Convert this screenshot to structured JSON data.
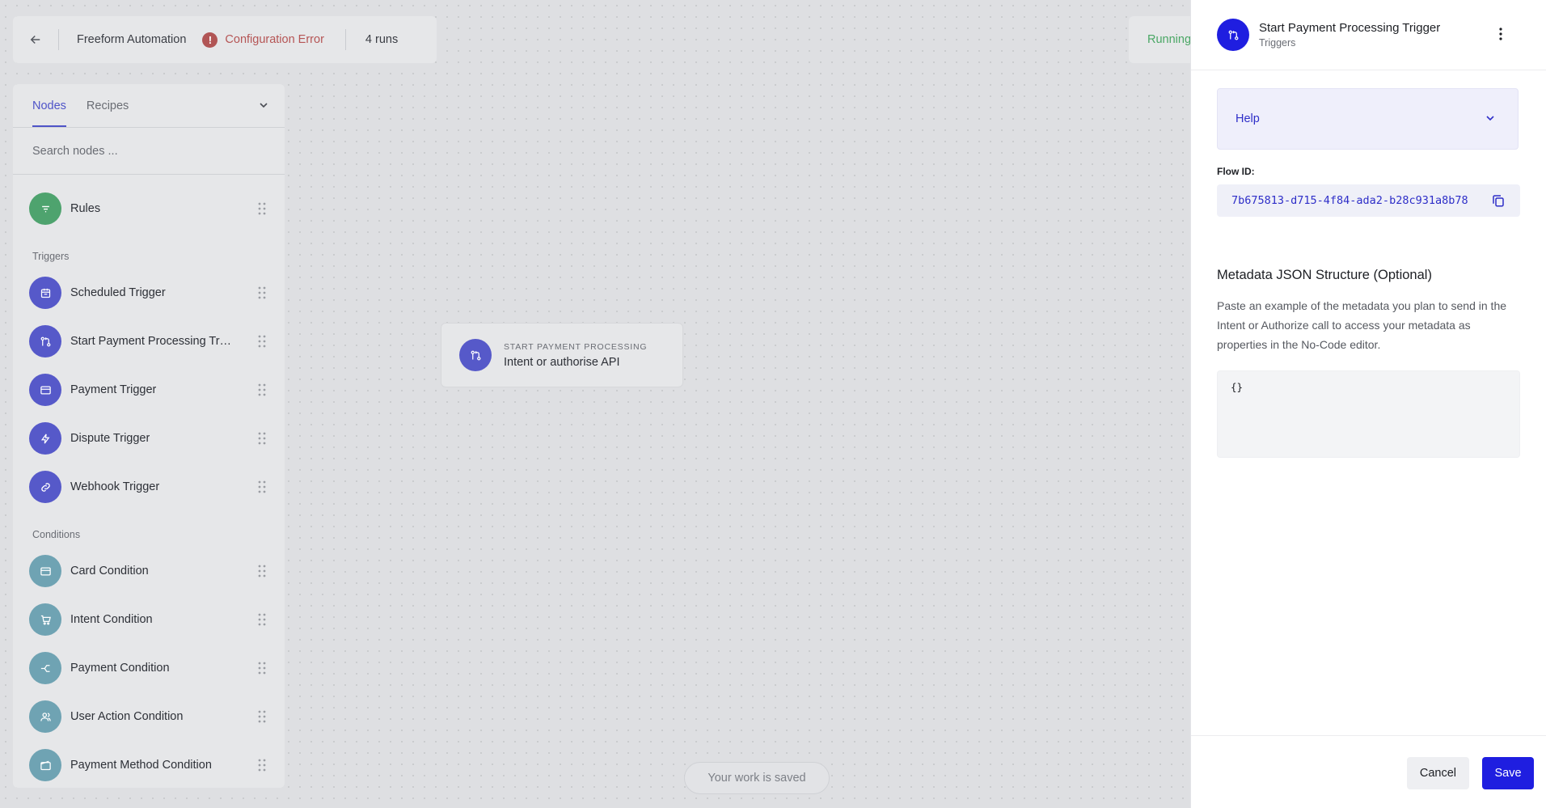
{
  "topbar": {
    "title": "Freeform Automation",
    "error_label": "Configuration Error",
    "error_icon": "!",
    "runs": "4 runs",
    "status": "Running"
  },
  "panel": {
    "tabs": [
      "Nodes",
      "Recipes"
    ],
    "active_tab": "Nodes",
    "search_placeholder": "Search nodes ...",
    "top_items": [
      {
        "label": "Rules",
        "icon": "filter-icon",
        "color": "#4ea36e"
      }
    ],
    "sections": [
      {
        "title": "Triggers",
        "items": [
          {
            "label": "Scheduled Trigger",
            "icon": "calendar-icon"
          },
          {
            "label": "Start Payment Processing Trigger",
            "icon": "git-pull-icon"
          },
          {
            "label": "Payment Trigger",
            "icon": "card-icon"
          },
          {
            "label": "Dispute Trigger",
            "icon": "bolt-icon"
          },
          {
            "label": "Webhook Trigger",
            "icon": "link-icon"
          }
        ]
      },
      {
        "title": "Conditions",
        "items": [
          {
            "label": "Card Condition",
            "icon": "card-icon"
          },
          {
            "label": "Intent Condition",
            "icon": "cart-icon"
          },
          {
            "label": "Payment Condition",
            "icon": "split-icon"
          },
          {
            "label": "User Action Condition",
            "icon": "users-icon"
          },
          {
            "label": "Payment Method Condition",
            "icon": "wallet-icon"
          }
        ]
      }
    ]
  },
  "canvas": {
    "node_kicker": "START PAYMENT PROCESSING",
    "node_title": "Intent or authorise API",
    "saved_text": "Your work is saved"
  },
  "drawer": {
    "title": "Start Payment Processing Trigger",
    "subtitle": "Triggers",
    "help_label": "Help",
    "flow_id_label": "Flow ID:",
    "flow_id": "7b675813-d715-4f84-ada2-b28c931a8b78",
    "metadata_heading": "Metadata JSON Structure (Optional)",
    "metadata_desc": "Paste an example of the metadata you plan to send in the Intent or Authorize call to access your metadata as properties in the No-Code editor.",
    "json_value": "{}",
    "cancel_label": "Cancel",
    "save_label": "Save"
  },
  "colors": {
    "accent": "#1f1ee0",
    "trigger": "#5659c9",
    "rule": "#4ea36e",
    "condition": "#6fa3b3",
    "error": "#b55555",
    "running": "#4aa765"
  }
}
